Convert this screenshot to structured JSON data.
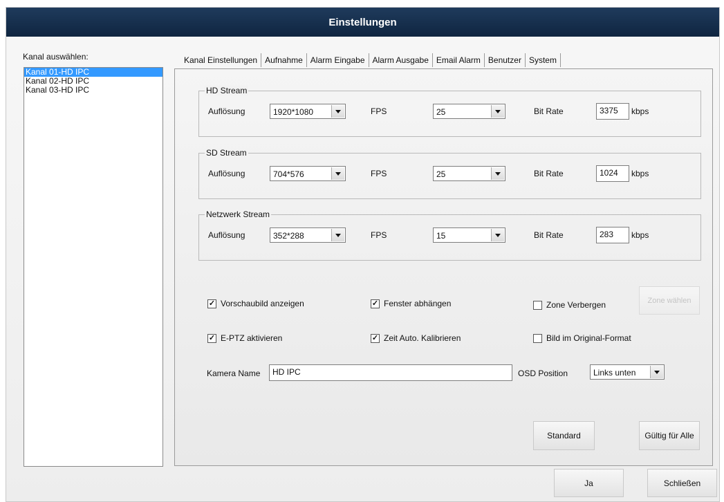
{
  "window": {
    "title": "Einstellungen"
  },
  "sidebar": {
    "label": "Kanal auswählen:",
    "channels": [
      "Kanal 01-HD IPC",
      "Kanal 02-HD IPC",
      "Kanal 03-HD IPC"
    ],
    "selected_index": 0
  },
  "tabs": [
    "Kanal Einstellungen",
    "Aufnahme",
    "Alarm Eingabe",
    "Alarm Ausgabe",
    "Email Alarm",
    "Benutzer",
    "System"
  ],
  "streams": [
    {
      "title": "HD Stream",
      "resolution_label": "Auflösung",
      "resolution": "1920*1080",
      "fps_label": "FPS",
      "fps": "25",
      "bitrate_label": "Bit Rate",
      "bitrate": "3375",
      "unit": "kbps"
    },
    {
      "title": "SD Stream",
      "resolution_label": "Auflösung",
      "resolution": "704*576",
      "fps_label": "FPS",
      "fps": "25",
      "bitrate_label": "Bit Rate",
      "bitrate": "1024",
      "unit": "kbps"
    },
    {
      "title": "Netzwerk Stream",
      "resolution_label": "Auflösung",
      "resolution": "352*288",
      "fps_label": "FPS",
      "fps": "15",
      "bitrate_label": "Bit Rate",
      "bitrate": "283",
      "unit": "kbps"
    }
  ],
  "options": {
    "preview": {
      "label": "Vorschaubild anzeigen",
      "checked": true
    },
    "detach": {
      "label": "Fenster abhängen",
      "checked": true
    },
    "hide_zone": {
      "label": "Zone Verbergen",
      "checked": false
    },
    "eptz": {
      "label": "E-PTZ aktivieren",
      "checked": true
    },
    "time_calib": {
      "label": "Zeit Auto. Kalibrieren",
      "checked": true
    },
    "original_format": {
      "label": "Bild im Original-Format",
      "checked": false
    },
    "zone_button": "Zone wählen"
  },
  "camera": {
    "name_label": "Kamera Name",
    "name_value": "HD IPC",
    "osd_label": "OSD Position",
    "osd_value": "Links unten"
  },
  "panel_buttons": {
    "standard": "Standard",
    "apply_all": "Gültig für Alle"
  },
  "footer": {
    "yes": "Ja",
    "close": "Schließen"
  },
  "colors": {
    "title_bar": "#1a3350",
    "selection": "#3399ff"
  }
}
